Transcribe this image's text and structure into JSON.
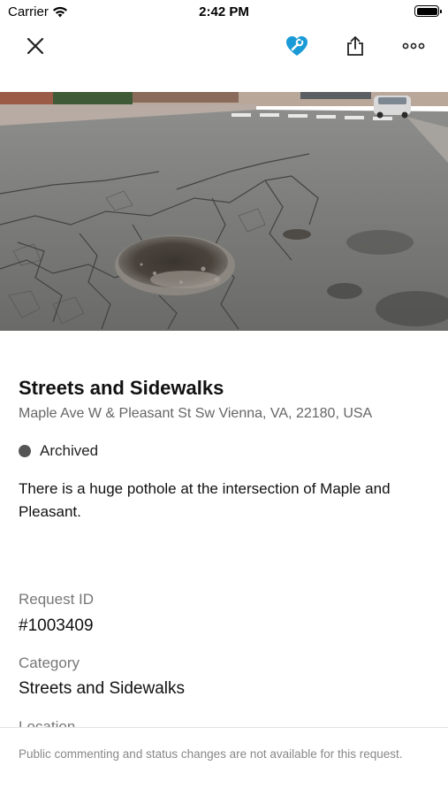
{
  "status_bar": {
    "carrier": "Carrier",
    "time": "2:42 PM",
    "wifi_icon": "wifi-icon",
    "battery_icon": "battery-icon"
  },
  "nav": {
    "close_icon": "close-icon",
    "follow_icon": "heart-wrench-icon",
    "follow_color": "#1a9ad6",
    "share_icon": "share-icon",
    "more_icon": "more-icon"
  },
  "request": {
    "title": "Streets and Sidewalks",
    "address": "Maple Ave W & Pleasant St Sw Vienna, VA, 22180, USA",
    "status": "Archived",
    "status_color": "#555555",
    "description": "There is a huge pothole at the intersection of Maple and Pleasant."
  },
  "details": {
    "request_id_label": "Request ID",
    "request_id_value": "#1003409",
    "category_label": "Category",
    "category_value": "Streets and Sidewalks",
    "location_label": "Location"
  },
  "footer": {
    "notice": "Public commenting and status changes are not available for this request."
  }
}
